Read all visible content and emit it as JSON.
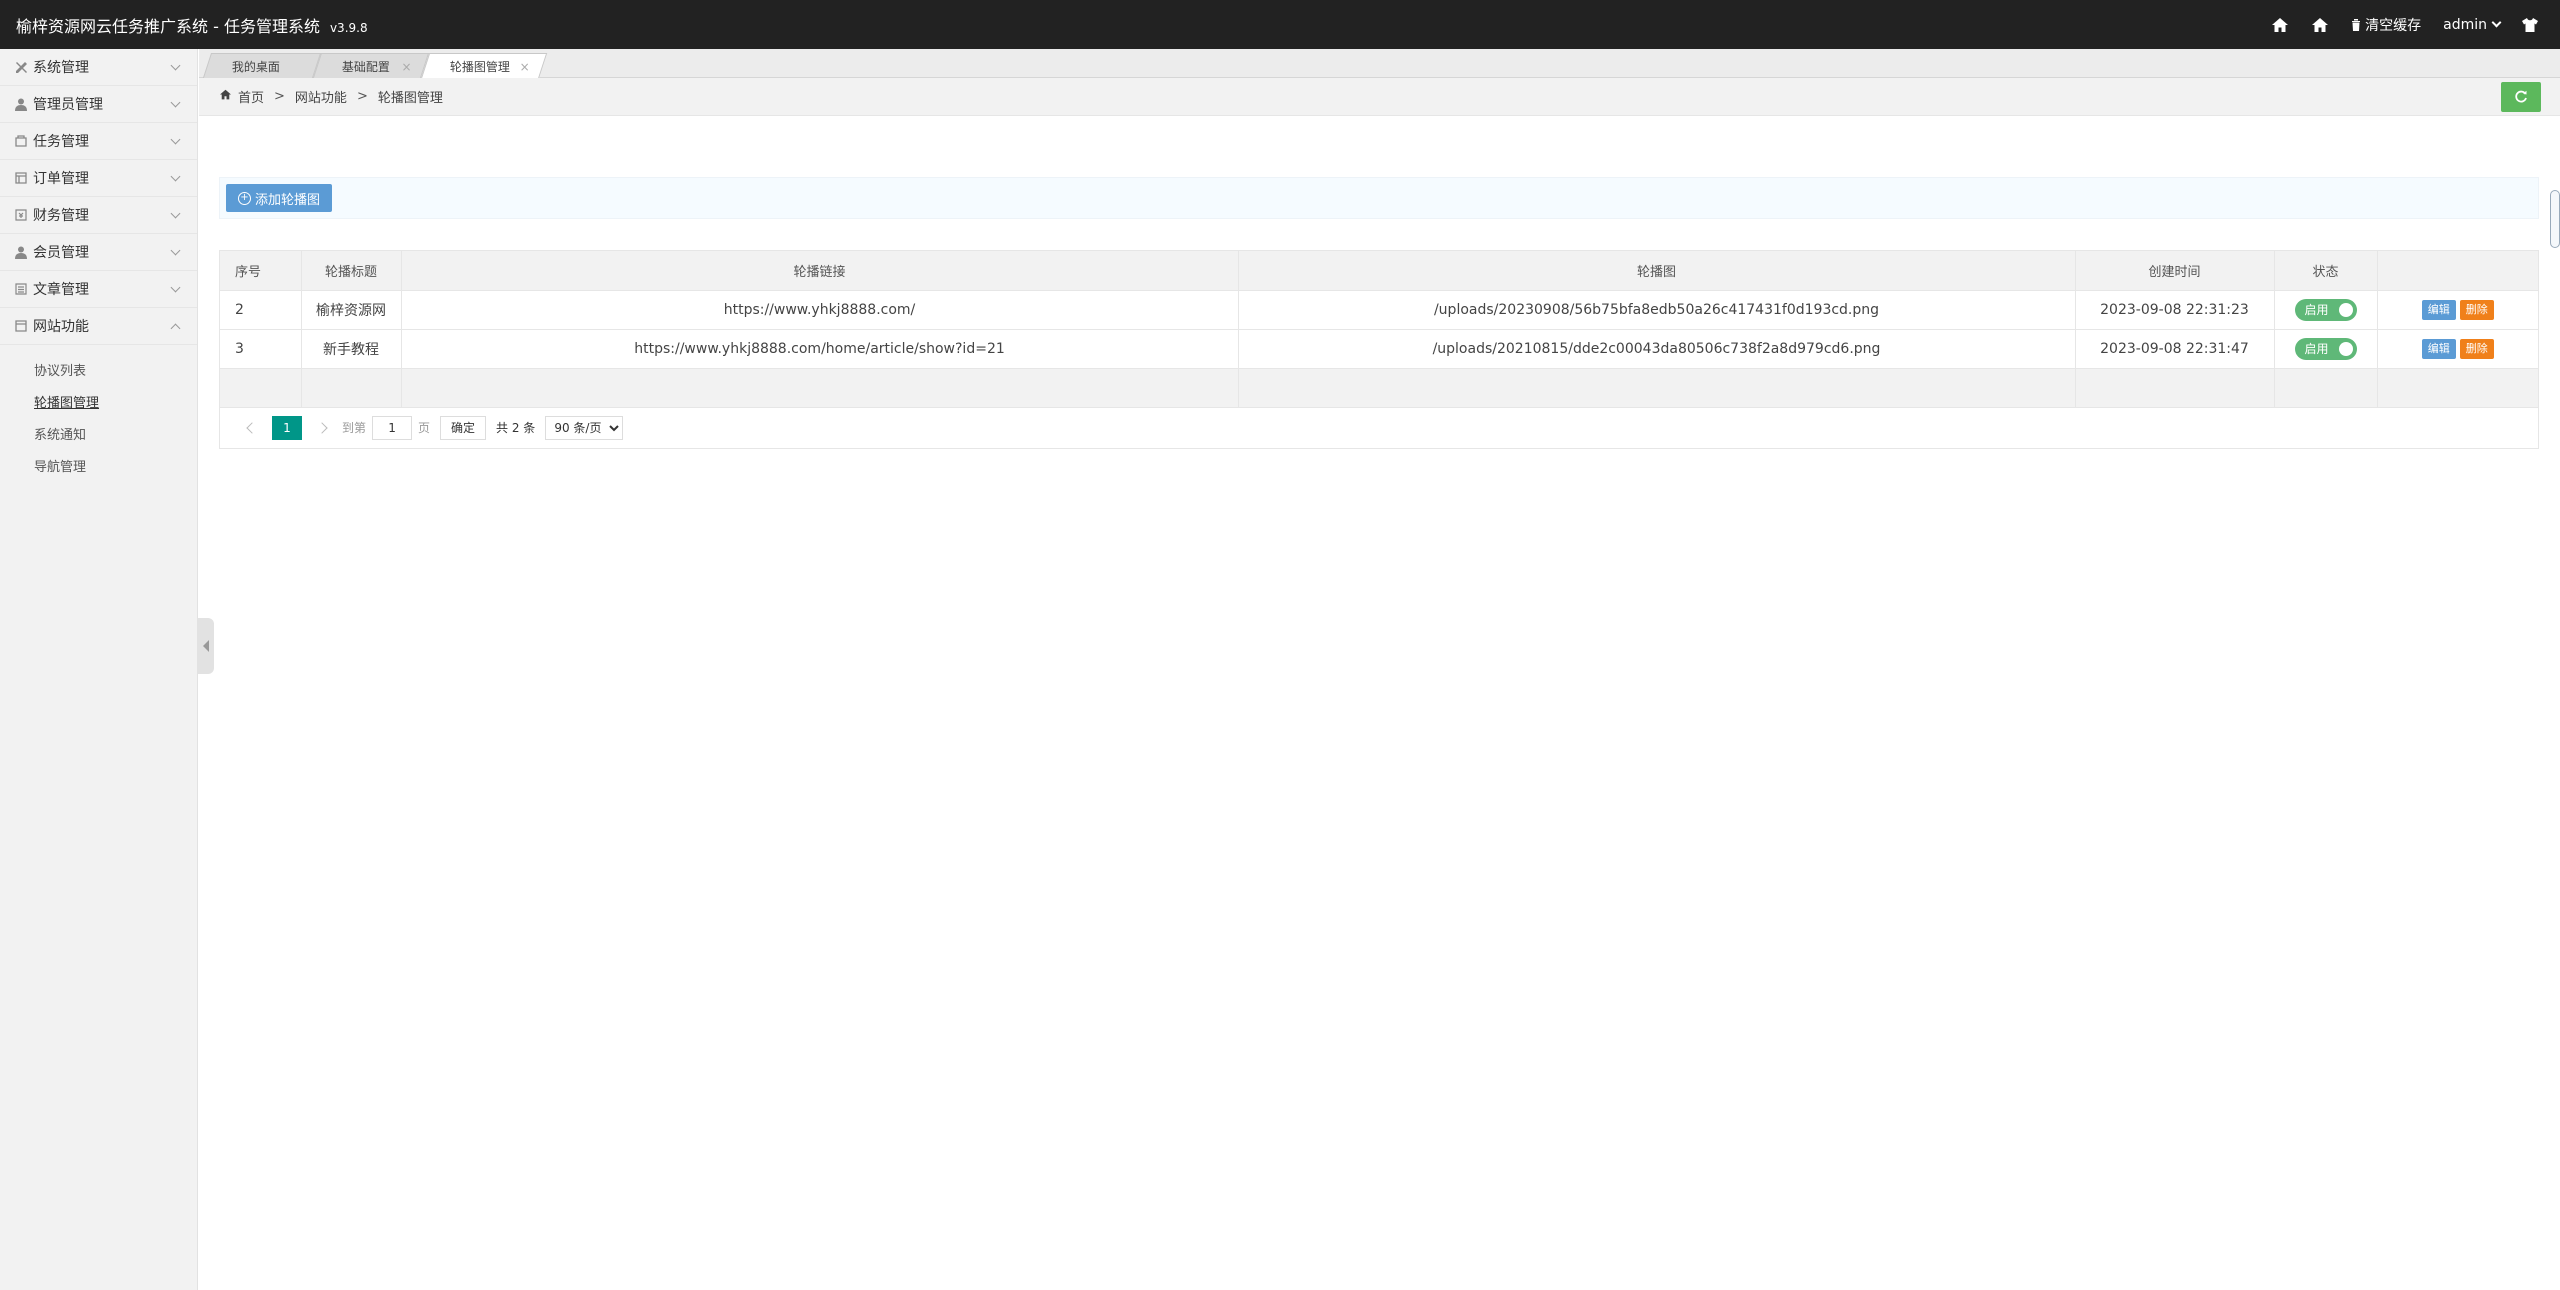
{
  "header": {
    "title": "榆梓资源网云任务推广系统 - 任务管理系统",
    "version": "v3.9.8",
    "clear_cache_label": "清空缓存",
    "user_label": "admin"
  },
  "sidebar": {
    "items": [
      {
        "label": "系统管理",
        "icon": "tools-icon"
      },
      {
        "label": "管理员管理",
        "icon": "user-icon"
      },
      {
        "label": "任务管理",
        "icon": "task-icon"
      },
      {
        "label": "订单管理",
        "icon": "order-icon"
      },
      {
        "label": "财务管理",
        "icon": "finance-icon"
      },
      {
        "label": "会员管理",
        "icon": "member-icon"
      },
      {
        "label": "文章管理",
        "icon": "article-icon"
      },
      {
        "label": "网站功能",
        "icon": "site-icon"
      }
    ],
    "sub_items": [
      "协议列表",
      "轮播图管理",
      "系统通知",
      "导航管理"
    ]
  },
  "tabs": [
    {
      "label": "我的桌面"
    },
    {
      "label": "基础配置",
      "close": "×"
    },
    {
      "label": "轮播图管理",
      "close": "×"
    }
  ],
  "breadcrumb": {
    "home": "首页",
    "sep": ">",
    "level1": "网站功能",
    "level2": "轮播图管理"
  },
  "toolbar": {
    "add_label": "添加轮播图"
  },
  "table": {
    "headers": [
      "序号",
      "轮播标题",
      "轮播链接",
      "轮播图",
      "创建时间",
      "状态",
      ""
    ],
    "rows": [
      {
        "id": "2",
        "title": "榆梓资源网",
        "link": "https://www.yhkj8888.com/",
        "image": "/uploads/20230908/56b75bfa8edb50a26c417431f0d193cd.png",
        "created": "2023-09-08 22:31:23",
        "status": "启用"
      },
      {
        "id": "3",
        "title": "新手教程",
        "link": "https://www.yhkj8888.com/home/article/show?id=21",
        "image": "/uploads/20210815/dde2c00043da80506c738f2a8d979cd6.png",
        "created": "2023-09-08 22:31:47",
        "status": "启用"
      }
    ],
    "edit_label": "编辑",
    "delete_label": "删除"
  },
  "pager": {
    "current": "1",
    "goto_label": "到第",
    "page_input": "1",
    "page_unit": "页",
    "confirm_label": "确定",
    "total_label": "共 2 条",
    "page_size": "90 条/页"
  },
  "colors": {
    "header_bg": "#222222",
    "switch_on": "#5fb878",
    "primary": "#5b9bd5",
    "danger": "#f0801a",
    "pager_active": "#009688",
    "refresh": "#5cb85c"
  }
}
